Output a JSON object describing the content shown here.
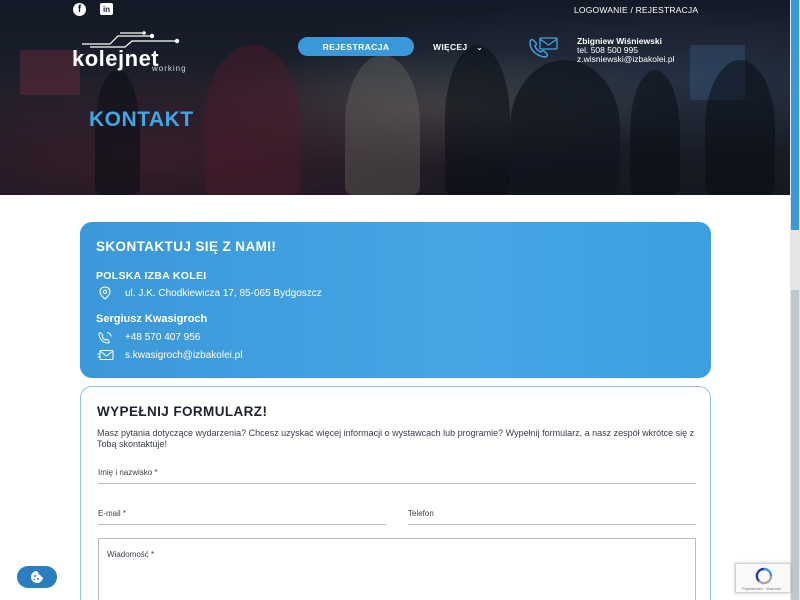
{
  "header": {
    "login_link": "LOGOWANIE / REJESTRACJA",
    "social": [
      {
        "name": "facebook",
        "glyph": "f"
      },
      {
        "name": "linkedin",
        "glyph": "in"
      }
    ],
    "logo": {
      "word": "kolejnet",
      "sub": "working"
    },
    "register_button": "REJESTRACJA",
    "more_menu": "WIĘCEJ",
    "contact": {
      "name": "Zbigniew Wiśniewski",
      "tel": "tel. 508 500 995",
      "email": "z.wisniewski@izbakolei.pl"
    },
    "page_title": "KONTAKT"
  },
  "contact_card": {
    "heading": "SKONTAKTUJ SIĘ Z NAMI!",
    "organization": "POLSKA IZBA KOLEI",
    "address": "ul. J.K. Chodkiewicza 17, 85-065 Bydgoszcz",
    "person": "Sergiusz Kwasigroch",
    "phone": "+48 570 407 956",
    "email": "s.kwasigroch@izbakolei.pl"
  },
  "form": {
    "heading": "WYPEŁNIJ FORMULARZ!",
    "description": "Masz pytania dotyczące wydarzenia? Chcesz uzyskać więcej informacji o wystawcach lub programie? Wypełnij formularz, a nasz zespół wkrótce się z Tobą skontaktuje!",
    "fields": {
      "name_label": "Imię i nazwisko *",
      "email_label": "E-mail *",
      "phone_label": "Telefon",
      "message_label": "Wiadomość *"
    }
  },
  "recaptcha": {
    "text": "Prywatność · Warunki"
  },
  "colors": {
    "accent": "#3b98d9",
    "title_blue": "#3fa6e8",
    "hero_dark": "#1b2030"
  }
}
